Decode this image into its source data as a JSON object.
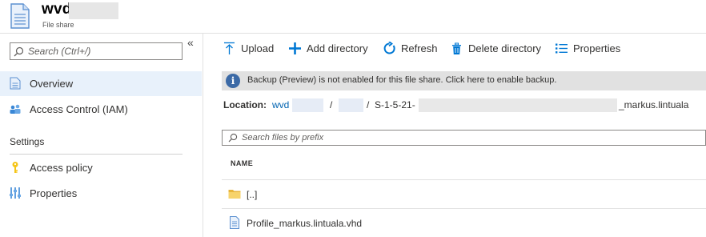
{
  "header": {
    "title": "wvd",
    "subtitle": "File share"
  },
  "sidebar": {
    "collapse_glyph": "«",
    "search_placeholder": "Search (Ctrl+/)",
    "items": [
      {
        "label": "Overview",
        "icon": "file-icon",
        "active": true
      },
      {
        "label": "Access Control (IAM)",
        "icon": "people-icon",
        "active": false
      }
    ],
    "section_title": "Settings",
    "settings_items": [
      {
        "label": "Access policy",
        "icon": "key-icon"
      },
      {
        "label": "Properties",
        "icon": "sliders-icon"
      }
    ]
  },
  "toolbar": {
    "upload": "Upload",
    "add_directory": "Add directory",
    "refresh": "Refresh",
    "delete_directory": "Delete directory",
    "properties": "Properties"
  },
  "banner": {
    "icon": "info-icon",
    "glyph": "i",
    "message": "Backup (Preview) is not enabled for this file share. Click here to enable backup."
  },
  "location": {
    "label": "Location:",
    "link": "wvd",
    "separator": "/",
    "sid_prefix": "S-1-5-21-",
    "sid_suffix": "_markus.lintuala"
  },
  "filter": {
    "placeholder": "Search files by prefix"
  },
  "table": {
    "column_name": "NAME",
    "rows": [
      {
        "name": "[..]",
        "icon": "folder-icon"
      },
      {
        "name": "Profile_markus.lintuala.vhd",
        "icon": "document-icon"
      }
    ]
  },
  "colors": {
    "accent": "#0078d4",
    "active_bg": "#e8f1fb",
    "banner_bg": "#e1e1e1",
    "info_icon": "#3c6aa6",
    "folder": "#f2c94c",
    "key": "#f5c518"
  }
}
